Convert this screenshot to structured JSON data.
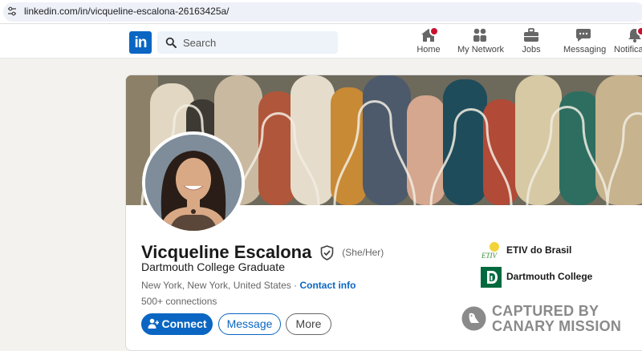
{
  "browser": {
    "url": "linkedin.com/in/vicqueline-escalona-26163425a/"
  },
  "header": {
    "logo_text": "in",
    "search_placeholder": "Search",
    "nav": [
      {
        "id": "home",
        "label": "Home",
        "icon": "home-icon",
        "has_badge": true
      },
      {
        "id": "network",
        "label": "My Network",
        "icon": "people-icon"
      },
      {
        "id": "jobs",
        "label": "Jobs",
        "icon": "briefcase-icon"
      },
      {
        "id": "messaging",
        "label": "Messaging",
        "icon": "chat-icon"
      },
      {
        "id": "notifications",
        "label": "Notificat",
        "icon": "bell-icon",
        "has_badge": true
      }
    ]
  },
  "profile": {
    "name": "Vicqueline Escalona",
    "pronouns": "(She/Her)",
    "headline": "Dartmouth College Graduate",
    "location": "New York, New York, United States",
    "separator": " · ",
    "contact_info_label": "Contact info",
    "connections": "500+ connections",
    "actions": {
      "connect": "Connect",
      "message": "Message",
      "more": "More"
    },
    "organizations": [
      {
        "name": "ETIV do Brasil",
        "logo_text": "ETIV"
      },
      {
        "name": "Dartmouth College"
      }
    ]
  },
  "watermark": {
    "line1": "CAPTURED BY",
    "line2": "CANARY MISSION"
  },
  "colors": {
    "brand_blue": "#0a66c2",
    "badge_red": "#cb112d",
    "page_bg": "#f4f2ee",
    "dartmouth_green": "#00693e"
  }
}
